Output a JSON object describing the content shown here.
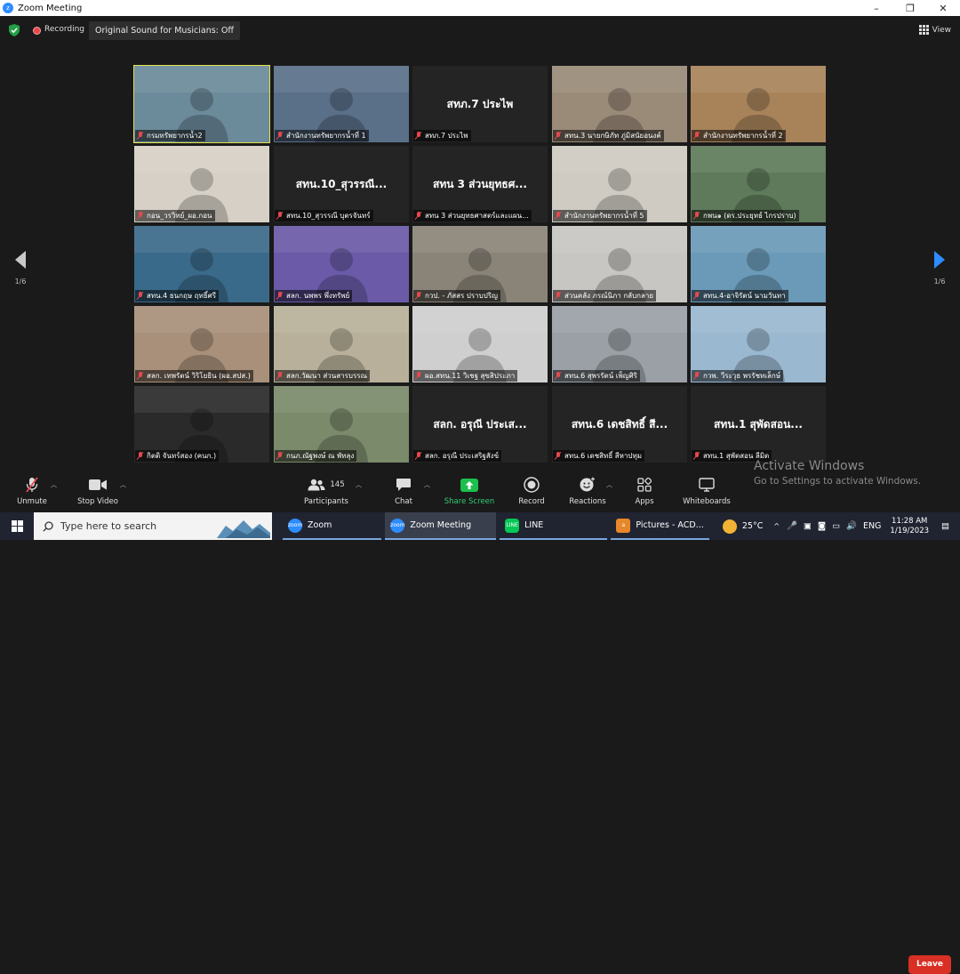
{
  "window": {
    "title": "Zoom Meeting",
    "minimize": "–",
    "maximize": "❐",
    "close": "✕"
  },
  "topbar": {
    "recording_label": "Recording",
    "original_sound": "Original Sound for Musicians: Off",
    "view_label": "View"
  },
  "pager": {
    "left": "1/6",
    "right": "1/6"
  },
  "tiles": [
    {
      "name": "กรมทรัพยากรน้ำ2",
      "center": "",
      "bg": "#6b8a9a",
      "active": true
    },
    {
      "name": "สำนักงานทรัพยากรน้ำที่ 1",
      "center": "",
      "bg": "#5a6f88"
    },
    {
      "name": "สทภ.7 ประไพ",
      "center": "สทภ.7 ประไพ",
      "bg": "#242424"
    },
    {
      "name": "สทน.3 นายกษิภัท ภู่มิสนัยอนงค์",
      "center": "",
      "bg": "#9a8a78"
    },
    {
      "name": "สำนักงานทรัพยากรน้ำที่ 2",
      "center": "",
      "bg": "#a8835a"
    },
    {
      "name": "กอน_วรวิทย์_ผอ.กอน",
      "center": "",
      "bg": "#d6d0c6"
    },
    {
      "name": "สทน.10_สุวรรณี บุตรจันทร์",
      "center": "สทน.10_สุวรรณี...",
      "bg": "#242424"
    },
    {
      "name": "สทน 3 ส่วนยุทธศาสตร์และแผน...",
      "center": "สทน 3 ส่วนยุทธศ...",
      "bg": "#242424"
    },
    {
      "name": "สำนักงานทรัพยากรน้ำที่ 5",
      "center": "",
      "bg": "#cfcac2"
    },
    {
      "name": "กพน๑ (ดร.ประยุทธ์ ไกรปราบ)",
      "center": "",
      "bg": "#5e7a5a"
    },
    {
      "name": "สทน.4 ธนกฤษ ฤทธิ์ศรี",
      "center": "",
      "bg": "#3a6a8a"
    },
    {
      "name": "สลก. นพพร พึ่งทรัพย์",
      "center": "",
      "bg": "#6a5aa8"
    },
    {
      "name": "กวป. - ภัสสร ปราบปริญ",
      "center": "",
      "bg": "#8a8478"
    },
    {
      "name": "ส่วนคลัง ภรณ์นิภา กลับกลาย",
      "center": "",
      "bg": "#c8c6c2"
    },
    {
      "name": "สทน.4-อาจิรัตน์ นามวันทา",
      "center": "",
      "bg": "#6a9ab8"
    },
    {
      "name": "สลก. เทพรัตน์ วิริโยธิน (ผอ.สปส.)",
      "center": "",
      "bg": "#a8907a"
    },
    {
      "name": "สลก.วัฒนา ส่วนสารบรรณ",
      "center": "",
      "bg": "#b8b09a"
    },
    {
      "name": "ผอ.สทน.11 วิเชฐ สุขสิประภา",
      "center": "",
      "bg": "#cfcfcf"
    },
    {
      "name": "สทน.6 สุพรรัตน์ เพ็ญศิริ",
      "center": "",
      "bg": "#9aa0a6"
    },
    {
      "name": "กวพ. วีระวุธ พรรัชทเล็กษ์",
      "center": "",
      "bg": "#9ab8d0"
    },
    {
      "name": "กิตติ จันทร์สอง (คนก.)",
      "center": "",
      "bg": "#2a2a2a"
    },
    {
      "name": "กนภ.ณัฐพงษ์ ณ พัทลุง",
      "center": "",
      "bg": "#7a8a6a"
    },
    {
      "name": "สลก. อรุณี ประเสริฐสังข์",
      "center": "สลก. อรุณี ประเส...",
      "bg": "#242424"
    },
    {
      "name": "สทน.6 เดชสิทธิ์ สีหาปทุม",
      "center": "สทน.6 เดชสิทธิ์ สี...",
      "bg": "#242424"
    },
    {
      "name": "สทน.1 สุพัตสอน ลีมิต",
      "center": "สทน.1 สุพัดสอน...",
      "bg": "#242424"
    }
  ],
  "toolbar": {
    "unmute": "Unmute",
    "stop_video": "Stop Video",
    "participants": "Participants",
    "participants_count": "145",
    "chat": "Chat",
    "share_screen": "Share Screen",
    "record": "Record",
    "reactions": "Reactions",
    "apps": "Apps",
    "whiteboards": "Whiteboards",
    "leave": "Leave",
    "green": "#1dbf4c",
    "leave_color": "#d93025"
  },
  "watermark": {
    "line1": "Activate Windows",
    "line2": "Go to Settings to activate Windows."
  },
  "taskbar": {
    "search_placeholder": "Type here to search",
    "items": [
      "Zoom",
      "Zoom Meeting",
      "LINE",
      "Pictures - ACD..."
    ],
    "temperature": "25°C",
    "language": "ENG",
    "time": "11:28 AM",
    "date": "1/19/2023"
  }
}
